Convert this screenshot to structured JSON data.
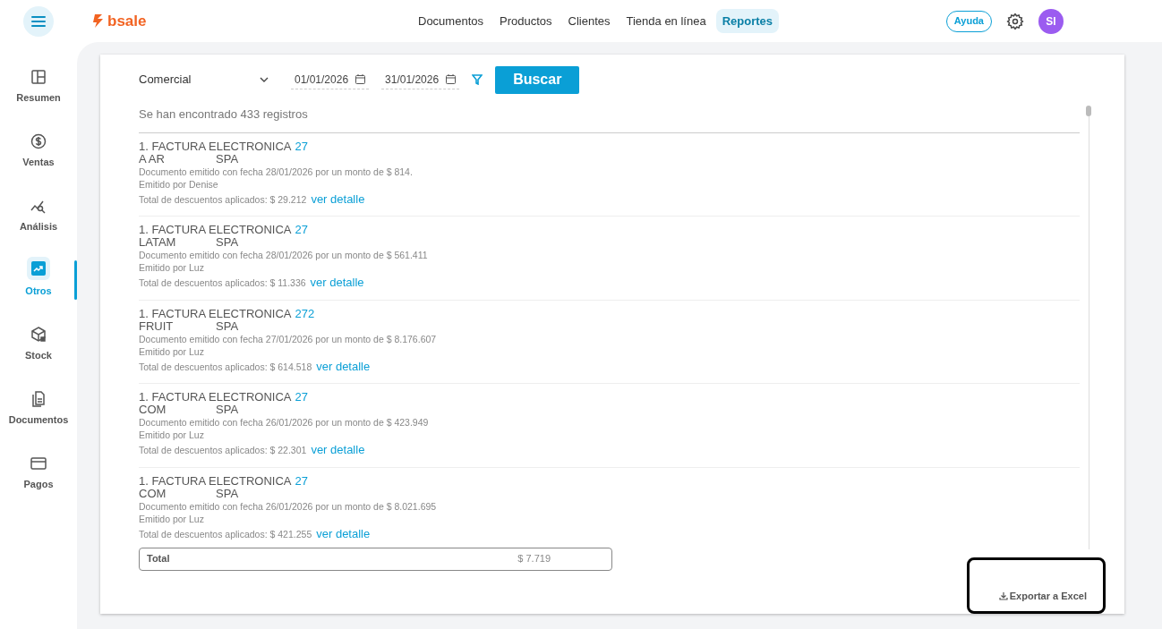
{
  "header": {
    "logo": "bsale",
    "nav": [
      {
        "label": "Documentos",
        "selected": false
      },
      {
        "label": "Productos",
        "selected": false
      },
      {
        "label": "Clientes",
        "selected": false
      },
      {
        "label": "Tienda en línea",
        "selected": false
      },
      {
        "label": "Reportes",
        "selected": true
      }
    ],
    "help": "Ayuda",
    "avatar": "SI"
  },
  "sidebar": {
    "items": [
      {
        "label": "Resumen",
        "selected": false
      },
      {
        "label": "Ventas",
        "selected": false
      },
      {
        "label": "Análisis",
        "selected": false
      },
      {
        "label": "Otros",
        "selected": true
      },
      {
        "label": "Stock",
        "selected": false
      },
      {
        "label": "Documentos",
        "selected": false
      },
      {
        "label": "Pagos",
        "selected": false
      }
    ]
  },
  "filters": {
    "type": "Comercial",
    "date_from": "01/01/2026",
    "date_to": "31/01/2026",
    "search_button": "Buscar"
  },
  "result_count": "Se han encontrado 433 registros",
  "records": [
    {
      "title": "1. FACTURA ELECTRONICA",
      "number": "27",
      "name_start": "A AR",
      "name_end": "SPA",
      "detail": "Documento emitido con fecha 28/01/2026 por un monto de $ 814.",
      "issuer": "Emitido por Denise",
      "discounts": "Total de descuentos aplicados: $ 29.212",
      "link": "ver detalle"
    },
    {
      "title": "1. FACTURA ELECTRONICA",
      "number": "27",
      "name_start": "LATAM",
      "name_end": "SPA",
      "detail": "Documento emitido con fecha 28/01/2026 por un monto de $ 561.411",
      "issuer": "Emitido por Luz",
      "discounts": "Total de descuentos aplicados: $ 11.336",
      "link": "ver detalle"
    },
    {
      "title": "1. FACTURA ELECTRONICA",
      "number": "272",
      "name_start": "FRUIT",
      "name_end": "SPA",
      "detail": "Documento emitido con fecha 27/01/2026 por un monto de $ 8.176.607",
      "issuer": "Emitido por Luz",
      "discounts": "Total de descuentos aplicados: $ 614.518",
      "link": "ver detalle"
    },
    {
      "title": "1. FACTURA ELECTRONICA",
      "number": "27",
      "name_start": "COM",
      "name_end": "SPA",
      "detail": "Documento emitido con fecha 26/01/2026 por un monto de $ 423.949",
      "issuer": "Emitido por Luz",
      "discounts": "Total de descuentos aplicados: $ 22.301",
      "link": "ver detalle"
    },
    {
      "title": "1. FACTURA ELECTRONICA",
      "number": "27",
      "name_start": "COM",
      "name_end": "SPA",
      "detail": "Documento emitido con fecha 26/01/2026 por un monto de $ 8.021.695",
      "issuer": "Emitido por Luz",
      "discounts": "Total de descuentos aplicados: $ 421.255",
      "link": "ver detalle"
    }
  ],
  "total": {
    "label": "Total",
    "value": "$ 7.719"
  },
  "export_button": "Exportar a Excel"
}
